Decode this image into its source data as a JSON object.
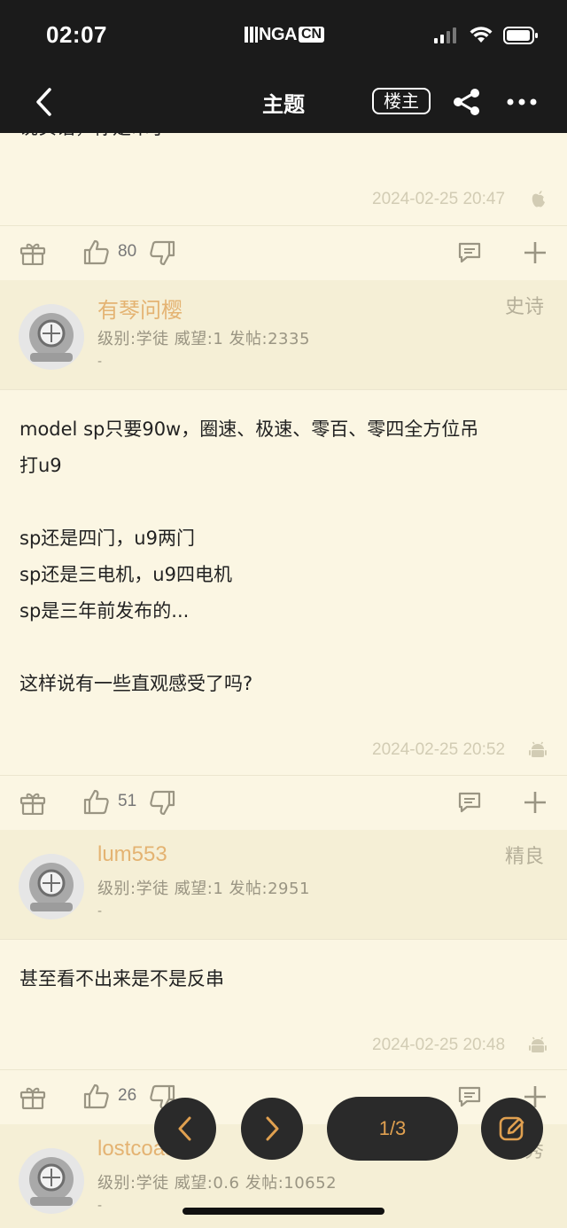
{
  "status": {
    "time": "02:07",
    "logo_text": "NGA",
    "logo_suffix": "CN"
  },
  "nav": {
    "title": "主题",
    "owner_label": "楼主"
  },
  "posts": [
    {
      "body_partial": "说实话，你是串子",
      "timestamp": "2024-02-25 20:47",
      "client_icon": "apple-icon",
      "likes": "80"
    },
    {
      "author": "有琴问樱",
      "rank": "史诗",
      "meta": "级别:学徒  威望:1  发帖:2335",
      "signature": "-",
      "body_lines": [
        "model sp只要90w，圈速、极速、零百、零四全方位吊",
        "打u9",
        "",
        "sp还是四门，u9两门",
        "sp还是三电机，u9四电机",
        "sp是三年前发布的...",
        "",
        "这样说有一些直观感受了吗?"
      ],
      "timestamp": "2024-02-25 20:52",
      "client_icon": "android-icon",
      "likes": "51"
    },
    {
      "author": "lum553",
      "rank": "精良",
      "meta": "级别:学徒  威望:1  发帖:2951",
      "signature": "-",
      "body_lines": [
        "甚至看不出来是不是反串"
      ],
      "timestamp": "2024-02-25 20:48",
      "client_icon": "android-icon",
      "likes": "26"
    },
    {
      "author": "lostcoaster",
      "rank": "精秀",
      "meta": "级别:学徒  威望:0.6  发帖:10652",
      "signature": "-"
    }
  ],
  "pager": {
    "label": "1/3"
  },
  "colors": {
    "accent": "#E4B372",
    "background": "#FBF6E3",
    "header": "#1B1B1B",
    "page_label": "#E0A050"
  }
}
